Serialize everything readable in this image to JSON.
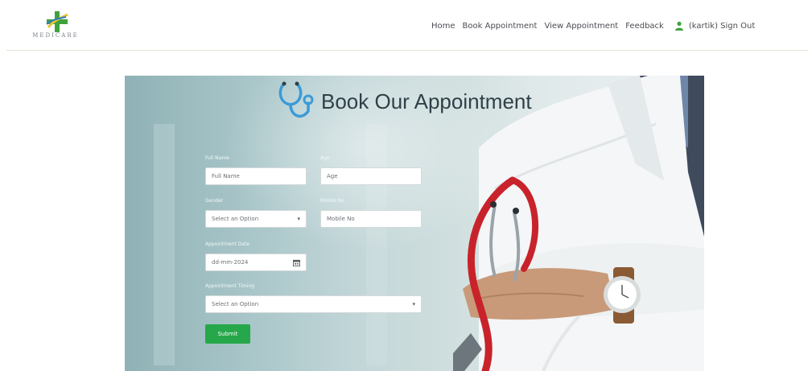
{
  "header": {
    "logo_text": "MEDICARE",
    "nav": {
      "home": "Home",
      "book": "Book Appointment",
      "view": "View Appointment",
      "feedback": "Feedback",
      "user": "(kartik) Sign Out"
    }
  },
  "hero": {
    "title": "Book Our Appointment"
  },
  "form": {
    "full_name": {
      "label": "Full Name",
      "placeholder": "Full Name"
    },
    "age": {
      "label": "Age",
      "placeholder": "Age"
    },
    "gender": {
      "label": "Gender",
      "value": "Select an Option"
    },
    "mobile": {
      "label": "Mobile No",
      "placeholder": "Mobile No"
    },
    "date": {
      "label": "Appointment Date",
      "value": "dd-mm-2024"
    },
    "timing": {
      "label": "Appointment Timing",
      "value": "Select an Option"
    },
    "submit_label": "Submit"
  },
  "colors": {
    "accent_green": "#26a74a",
    "logo_green": "#3ea33c",
    "logo_yellow": "#e9c13a",
    "logo_blue": "#2d7dbb",
    "stethoscope_blue": "#3a9bd8",
    "title_text": "#2f4048"
  },
  "icons": {
    "logo": "medical-cross-logo",
    "user": "user-icon",
    "hero": "stethoscope-icon",
    "calendar": "calendar-icon"
  }
}
